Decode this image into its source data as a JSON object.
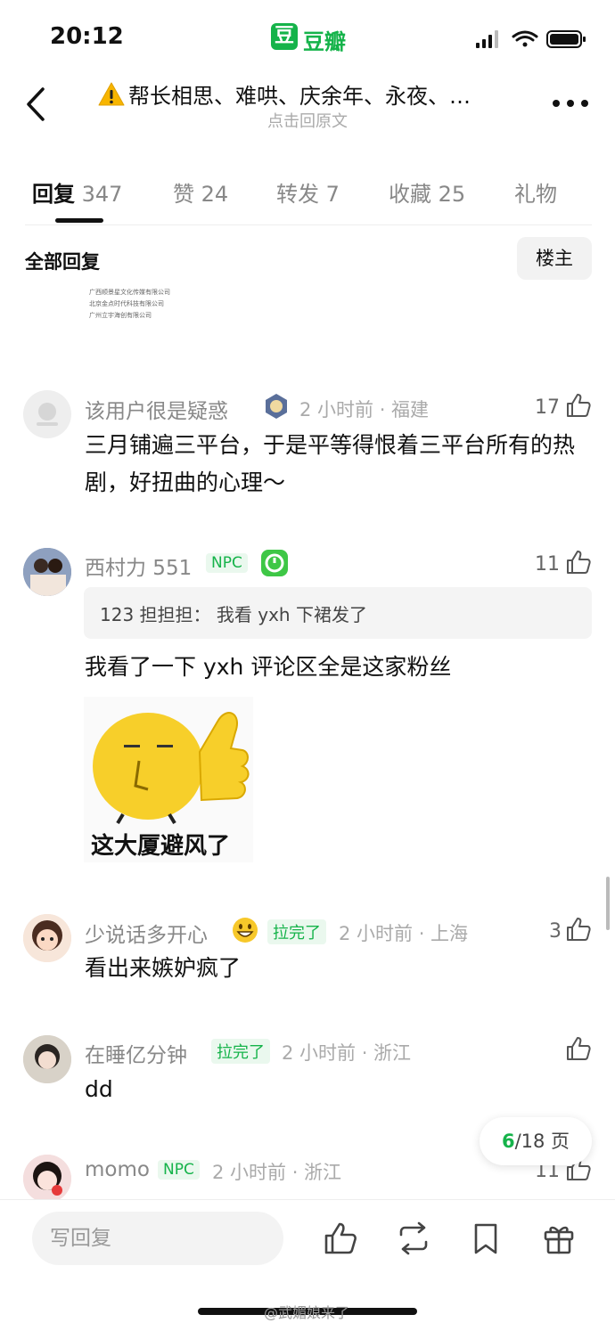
{
  "status_bar": {
    "time": "20:12",
    "app_logo_char": "豆",
    "app_name": "豆瓣"
  },
  "header": {
    "title": "帮长相思、难哄、庆余年、永夜、…",
    "subtitle": "点击回原文"
  },
  "tabs": [
    {
      "label": "回复",
      "count": "347",
      "active": true
    },
    {
      "label": "赞",
      "count": "24"
    },
    {
      "label": "转发",
      "count": "7"
    },
    {
      "label": "收藏",
      "count": "25"
    },
    {
      "label": "礼物",
      "count": ""
    }
  ],
  "section": {
    "title": "全部回复",
    "owner_button": "楼主"
  },
  "clipped_image_lines": [
    "广西顺景星文化传媒有限公司",
    "北京金点时代科技有限公司",
    "广州立宇海创有限公司"
  ],
  "comments": [
    {
      "username": "该用户很是疑惑",
      "meta": "2 小时前 · 福建",
      "likes": "17",
      "text": "三月铺遍三平台，于是平等得恨着三平台所有的热剧，好扭曲的心理～"
    },
    {
      "username": "西村力 551",
      "tag": "NPC",
      "likes": "11",
      "quote": "123 担担担：  我看 yxh 下裙发了",
      "text": "我看了一下 yxh 评论区全是这家粉丝",
      "sticker_caption": "这大厦避风了"
    },
    {
      "username": "少说话多开心",
      "tag": "拉完了",
      "meta": "2 小时前 · 上海",
      "likes": "3",
      "text": "看出来嫉妒疯了"
    },
    {
      "username": "在睡亿分钟",
      "tag": "拉完了",
      "meta": "2 小时前 · 浙江",
      "likes": "",
      "text": "dd"
    },
    {
      "username": "momo",
      "tag": "NPC",
      "meta": "2 小时前 · 浙江",
      "likes": "11"
    }
  ],
  "pagination": {
    "current": "6",
    "total": "/18 页"
  },
  "bottom_bar": {
    "reply_placeholder": "写回复"
  },
  "watermark": "@武媚娘来了",
  "colors": {
    "accent": "#15b34a",
    "text": "#111111",
    "muted": "#aaaaaa"
  },
  "icons": [
    "back-icon",
    "more-icon",
    "warning-icon",
    "like-icon",
    "repost-icon",
    "bookmark-icon",
    "gift-icon"
  ]
}
